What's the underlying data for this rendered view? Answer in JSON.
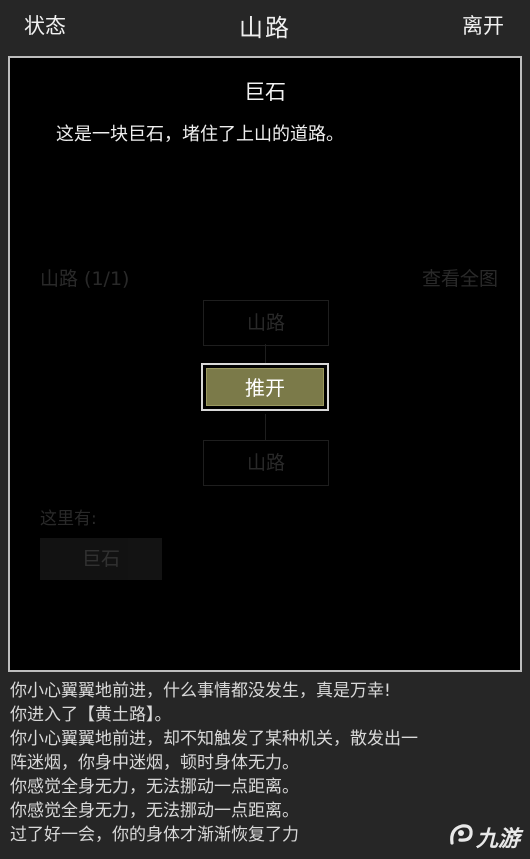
{
  "topbar": {
    "left_label": "状态",
    "title": "山路",
    "right_label": "离开"
  },
  "background": {
    "region_label": "山路 (1/1)",
    "view_all": "查看全图",
    "node_top": "山路",
    "node_bottom": "山路",
    "here_label": "这里有:",
    "thing_label": "巨石"
  },
  "dialog": {
    "title": "巨石",
    "description": "这是一块巨石，堵住了上山的道路。",
    "push_label": "推开"
  },
  "log": [
    "你小心翼翼地前进，什么事情都没发生，真是万幸!",
    "你进入了【黄土路】。",
    "你小心翼翼地前进，却不知触发了某种机关，散发出一",
    "阵迷烟，你身中迷烟，顿时身体无力。",
    "你感觉全身无力，无法挪动一点距离。",
    "你感觉全身无力，无法挪动一点距离。",
    "过了好一会，你的身体才渐渐恢复了力"
  ],
  "watermark": {
    "text": "九游",
    "logo_icon": "nine-game-logo-icon"
  },
  "colors": {
    "background": "#262626",
    "panel": "#000000",
    "button_fill": "#7b7a49",
    "border": "#bdbdbd"
  }
}
